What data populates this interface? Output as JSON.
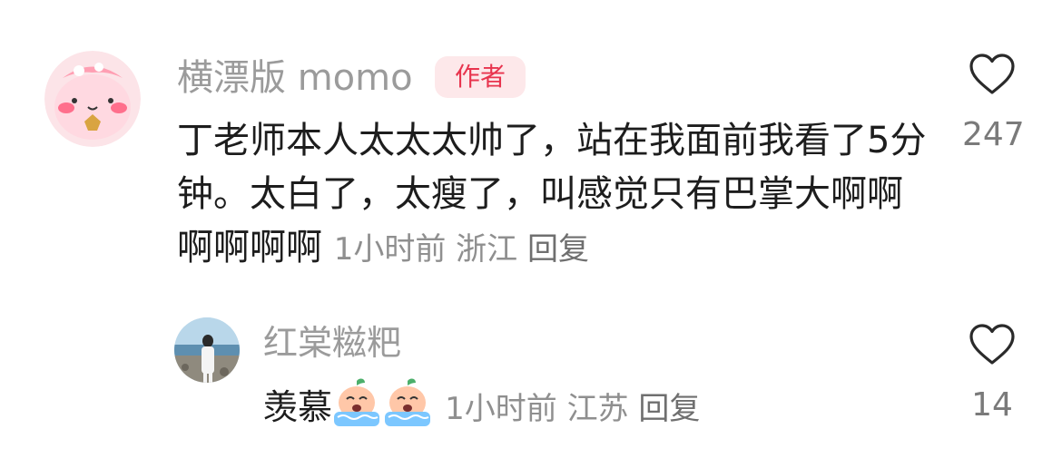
{
  "comments": [
    {
      "username": "横漂版 momo",
      "badge": "作者",
      "text": "丁老师本人太太太帅了，站在我面前我看了5分钟。太白了，太瘦了，叫感觉只有巴掌大啊啊啊啊啊啊",
      "time": "1小时前",
      "location": "浙江",
      "reply_label": "回复",
      "likes": "247",
      "avatar_icon": "pink-cartoon-avatar"
    }
  ],
  "replies": [
    {
      "username": "红棠糍粑",
      "text": "羡慕",
      "emojis": [
        "crying-peach-emoji",
        "crying-peach-emoji"
      ],
      "time": "1小时前",
      "location": "江苏",
      "reply_label": "回复",
      "likes": "14",
      "avatar_icon": "seaside-photo-avatar"
    }
  ],
  "colors": {
    "badge_bg": "#fde8ea",
    "badge_text": "#e8344e",
    "username": "#9b9b9b",
    "meta": "#8f8f8f"
  }
}
